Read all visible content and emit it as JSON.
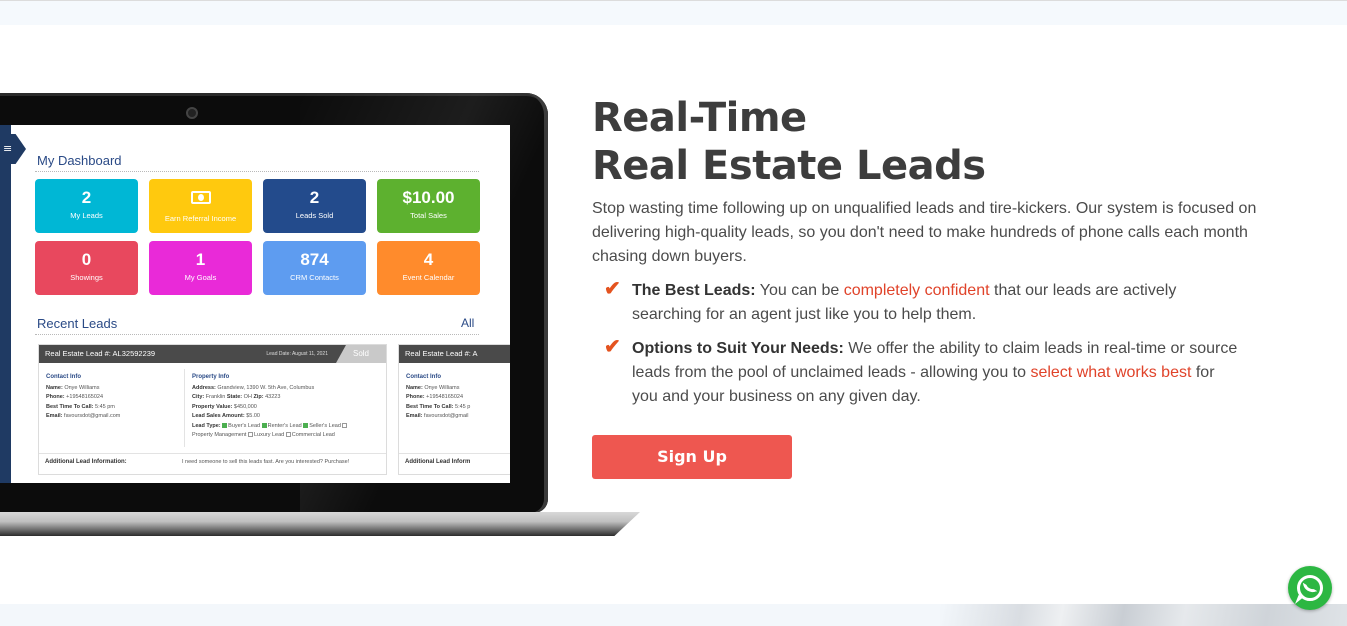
{
  "dashboard": {
    "title": "My Dashboard",
    "tiles": [
      {
        "value": "2",
        "label": "My Leads",
        "color": "#00b7d5"
      },
      {
        "value": "",
        "label": "Earn Referral Income",
        "color": "#ffc90e"
      },
      {
        "value": "2",
        "label": "Leads Sold",
        "color": "#234b8c"
      },
      {
        "value": "$10.00",
        "label": "Total Sales",
        "color": "#5db12f"
      },
      {
        "value": "0",
        "label": "Showings",
        "color": "#e8485e"
      },
      {
        "value": "1",
        "label": "My Goals",
        "color": "#e92ad8"
      },
      {
        "value": "874",
        "label": "CRM Contacts",
        "color": "#5e9cf0"
      },
      {
        "value": "4",
        "label": "Event Calendar",
        "color": "#ff8b2c"
      }
    ],
    "recent_title": "Recent Leads",
    "recent_all": "All",
    "lead": {
      "header": "Real Estate Lead #: AL32592239",
      "header_short": "Real Estate Lead #: A",
      "date": "Lead Date: August 11, 2021",
      "status": "Sold",
      "contact_heading": "Contact Info",
      "name_label": "Name:",
      "name": "Onye Williams",
      "phone_label": "Phone:",
      "phone": "+19548165024",
      "phone_short": "+19548165024",
      "call_label": "Best Time To Call:",
      "call": "5:45 pm",
      "call_short": "5:45 p",
      "email_label": "Email:",
      "email": "favoursdot@gmail.com",
      "email_short": "favoursdot@gmail",
      "property_heading": "Property Info",
      "address_label": "Address:",
      "address": "Grandview, 1390 W. 5th Ave, Columbus",
      "city_label": "City:",
      "city": "Franklin",
      "state_label": "State:",
      "state": "OH",
      "zip_label": "Zip:",
      "zip": "43223",
      "value_label": "Property Value:",
      "value": "$450,000",
      "amount_label": "Lead Sales Amount:",
      "amount": "$5.00",
      "type_label": "Lead Type:",
      "types": [
        "Buyer's Lead",
        "Renter's Lead",
        "Seller's Lead",
        "Property Management",
        "Luxury Lead",
        "Commercial Lead"
      ],
      "additional_label": "Additional Lead Information:",
      "additional_short": "Additional Lead Inform",
      "additional": "I need someone to sell this leads fast. Are you interested? Purchase!"
    }
  },
  "hero": {
    "headline_line1": "Real-Time",
    "headline_line2": "Real Estate Leads",
    "intro": "Stop wasting time following up on unqualified leads and tire-kickers. Our system is focused on delivering high-quality leads, so you don't need to make hundreds of phone calls each month chasing down buyers.",
    "features": [
      {
        "title": "The Best Leads:",
        "text_before": " You can be ",
        "highlight": "completely confident",
        "text_after": " that our leads are actively searching for an agent just like you to help them."
      },
      {
        "title": "Options to Suit Your Needs:",
        "text_before": " We offer the ability to claim leads in real-time or source leads from the pool of unclaimed leads - allowing you to ",
        "highlight": "select what works best",
        "text_after": " for you and your business on any given day."
      }
    ],
    "signup_label": "Sign Up"
  },
  "icons": {
    "menu": "menu-icon",
    "check": "checkmark-icon",
    "whatsapp": "whatsapp-icon"
  },
  "colors": {
    "accent": "#ee5750",
    "highlight_text": "#e0432a",
    "check": "#e4531f",
    "dashboard_blue": "#2a4a86"
  }
}
